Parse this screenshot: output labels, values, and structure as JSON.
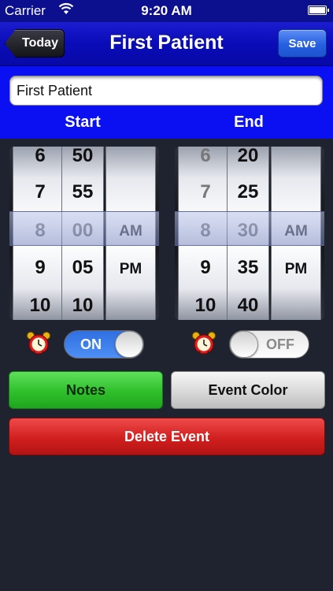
{
  "status_bar": {
    "carrier": "Carrier",
    "time": "9:20 AM",
    "wifi_icon": "wifi-icon",
    "battery_icon": "battery-icon"
  },
  "nav": {
    "back_label": "Today",
    "title": "First Patient",
    "save_label": "Save"
  },
  "event": {
    "name_value": "First Patient"
  },
  "labels": {
    "start": "Start",
    "end": "End"
  },
  "start_picker": {
    "hours": [
      "6",
      "7",
      "8",
      "9",
      "10"
    ],
    "minutes": [
      "50",
      "55",
      "00",
      "05",
      "10"
    ],
    "ampm": [
      "AM",
      "PM"
    ],
    "selected": {
      "hour": "8",
      "minute": "00",
      "ampm": "AM"
    }
  },
  "end_picker": {
    "hours": [
      "6",
      "7",
      "8",
      "9",
      "10"
    ],
    "minutes": [
      "20",
      "25",
      "30",
      "35",
      "40"
    ],
    "ampm": [
      "AM",
      "PM"
    ],
    "selected": {
      "hour": "8",
      "minute": "30",
      "ampm": "AM"
    }
  },
  "alarms": {
    "start": {
      "icon": "alarm-clock-icon",
      "state": "ON"
    },
    "end": {
      "icon": "alarm-clock-icon",
      "state": "OFF"
    }
  },
  "actions": {
    "notes_label": "Notes",
    "event_color_label": "Event Color",
    "delete_label": "Delete Event"
  },
  "colors": {
    "nav_blue": "#0a0cb8",
    "header_blue": "#0a10f2",
    "notes_green": "#2fbf2c",
    "delete_red": "#d11f1f",
    "toggle_on_blue": "#3a7ce8"
  }
}
